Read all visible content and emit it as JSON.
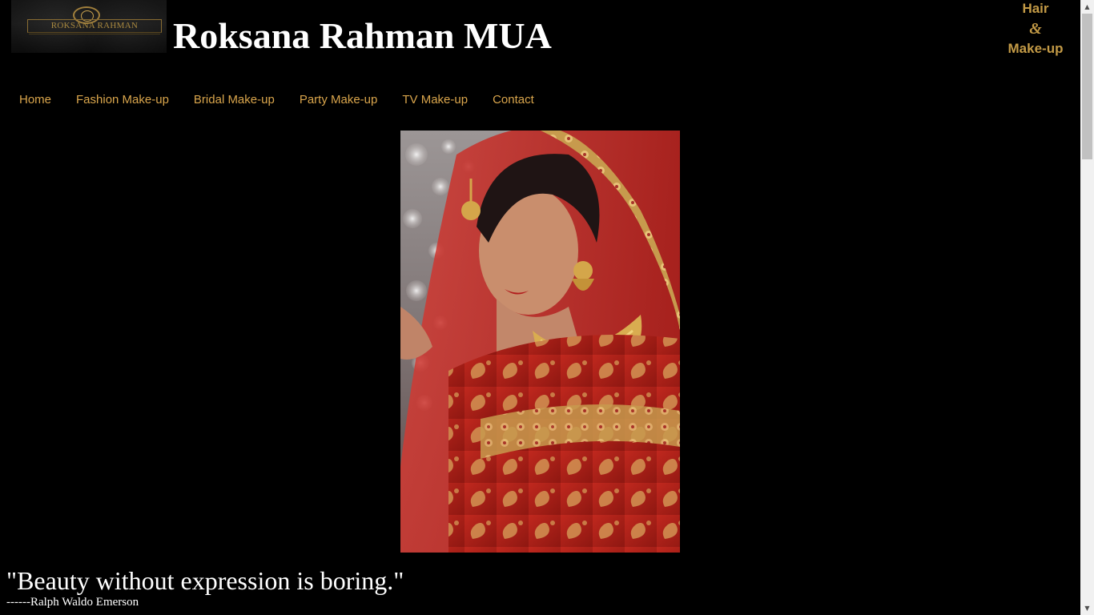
{
  "header": {
    "logo_text": "ROKSANA RAHMAN",
    "title": "Roksana Rahman MUA",
    "tagline": {
      "line1": "Hair",
      "line2": "&",
      "line3": "Make-up"
    }
  },
  "nav": {
    "items": [
      {
        "label": "Home"
      },
      {
        "label": "Fashion Make-up"
      },
      {
        "label": "Bridal Make-up"
      },
      {
        "label": "Party Make-up"
      },
      {
        "label": "TV Make-up"
      },
      {
        "label": "Contact"
      }
    ]
  },
  "quote": {
    "text": "\"Beauty without expression is boring.\"",
    "author": "------Ralph Waldo Emerson"
  },
  "colors": {
    "background": "#000000",
    "nav_link": "#d9a54c",
    "tagline": "#c39a46"
  }
}
